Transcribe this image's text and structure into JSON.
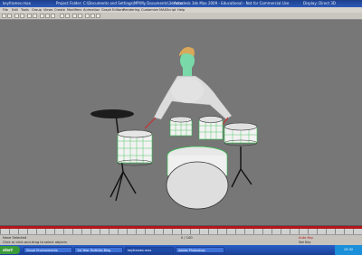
{
  "titlebar": {
    "items": [
      "keyframes.max",
      "Project Folder: C:\\Documents and Settings\\MP\\My Documents\\3dsmax",
      "Autodesk 3ds Max 2009 - Educational - Not for Commercial Use",
      "Display: Direct 3D"
    ]
  },
  "menubar": {
    "items": [
      "File",
      "Edit",
      "Tools",
      "Group",
      "Views",
      "Create",
      "Modifiers",
      "Animation",
      "Graph Editors",
      "Rendering",
      "Customize",
      "MAXScript",
      "Help"
    ]
  },
  "status": {
    "left_label": "None Selected",
    "prompt": "Click or click-and-drag to select objects",
    "frame_counter": "0 / 100",
    "key_mode": "Auto Key",
    "set_key": "Set Key"
  },
  "taskbar": {
    "start_label": "start",
    "tasks": [
      "Visual Environments",
      "1st Year Portfolio Blog",
      "keyframes.max",
      "Adobe Photoshop"
    ],
    "clock": "19:32"
  },
  "colors": {
    "viewport_bg": "#777777",
    "wire_green": "#2fbf4a",
    "timeline_red": "#b4161a",
    "taskbar_blue": "#2a5fc8"
  }
}
